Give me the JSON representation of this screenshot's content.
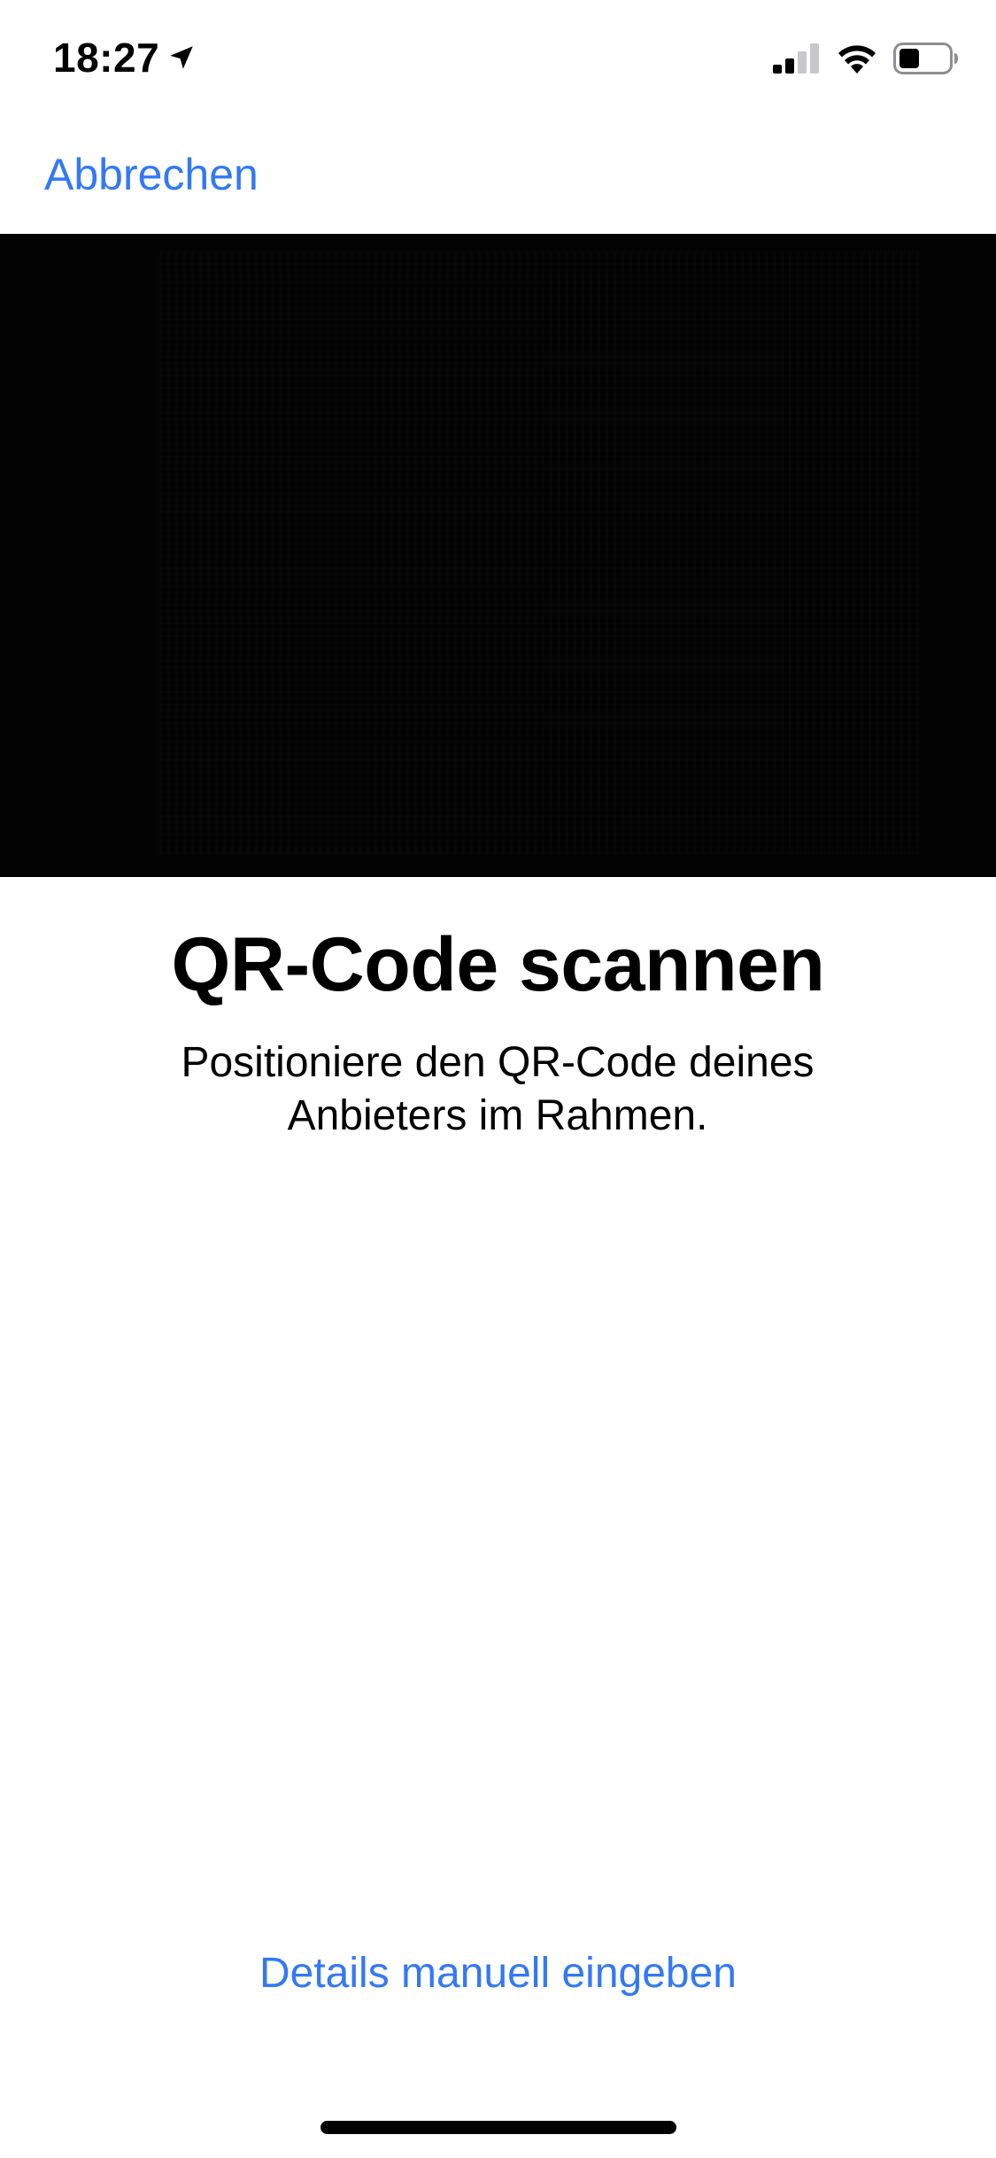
{
  "status_bar": {
    "time": "18:27",
    "icons": [
      "location-arrow-icon",
      "cellular-signal-icon",
      "wifi-icon",
      "battery-icon"
    ]
  },
  "nav": {
    "cancel_label": "Abbrechen"
  },
  "scanner": {
    "title": "QR-Code scannen",
    "instruction": "Positioniere den QR-Code deines Anbieters im Rahmen."
  },
  "actions": {
    "manual_entry_label": "Details manuell eingeben"
  },
  "colors": {
    "accent": "#3478f6",
    "camera_background": "#030303",
    "text": "#000000",
    "background": "#ffffff"
  }
}
